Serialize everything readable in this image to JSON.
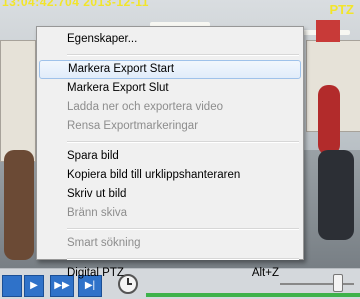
{
  "overlay": {
    "timestamp": "13:04:42.704 2013-12-11",
    "ptz_mark": "PTZ"
  },
  "menu": {
    "items": [
      {
        "label": "Egenskaper...",
        "enabled": true
      },
      {
        "separator": true
      },
      {
        "label": "Markera Export Start",
        "enabled": true,
        "highlighted": true
      },
      {
        "label": "Markera Export Slut",
        "enabled": true
      },
      {
        "label": "Ladda ner och exportera video",
        "enabled": false
      },
      {
        "label": "Rensa Exportmarkeringar",
        "enabled": false
      },
      {
        "separator": true
      },
      {
        "label": "Spara bild",
        "enabled": true
      },
      {
        "label": "Kopiera bild till urklippshanteraren",
        "enabled": true
      },
      {
        "label": "Skriv ut bild",
        "enabled": true
      },
      {
        "label": "Bränn skiva",
        "enabled": false
      },
      {
        "separator": true
      },
      {
        "label": "Smart sökning",
        "enabled": false
      },
      {
        "separator": true
      },
      {
        "label": "Digital PTZ",
        "enabled": true,
        "shortcut": "Alt+Z"
      }
    ]
  },
  "controls": {
    "buttons": [
      "",
      "▶",
      "▶▶",
      "▶|"
    ],
    "accent_color": "#2f72c9",
    "timeline_color": "#3db24a"
  }
}
